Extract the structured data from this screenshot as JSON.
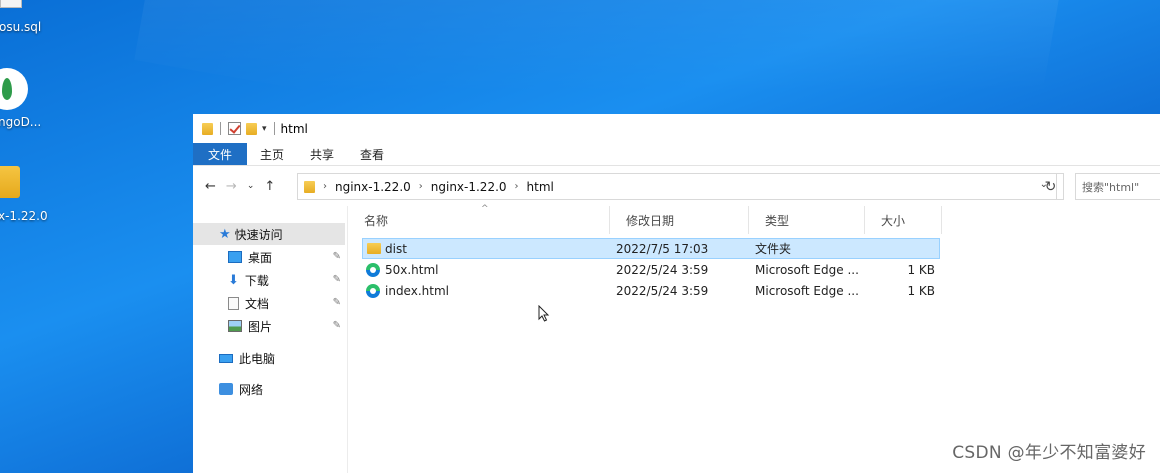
{
  "desktop": {
    "icons": [
      {
        "label": "osu.sql",
        "icon": "sql-file-icon"
      },
      {
        "label": "ngoD...",
        "icon": "mongodb-icon"
      },
      {
        "label": "x-1.22.0",
        "icon": "folder-icon"
      }
    ]
  },
  "window": {
    "title": "html",
    "quick_access_dropdown": "▾"
  },
  "ribbon": {
    "tabs": [
      "文件",
      "主页",
      "共享",
      "查看"
    ]
  },
  "address": {
    "crumbs": [
      "nginx-1.22.0",
      "nginx-1.22.0",
      "html"
    ],
    "search_placeholder": "搜索\"html\""
  },
  "nav_pane": {
    "quick_access": "快速访问",
    "items": [
      "桌面",
      "下载",
      "文档",
      "图片"
    ],
    "this_pc": "此电脑",
    "network": "网络"
  },
  "columns": [
    "名称",
    "修改日期",
    "类型",
    "大小"
  ],
  "files": [
    {
      "name": "dist",
      "date": "2022/7/5 17:03",
      "type": "文件夹",
      "size": "",
      "icon": "folder-icon",
      "selected": true
    },
    {
      "name": "50x.html",
      "date": "2022/5/24 3:59",
      "type": "Microsoft Edge ...",
      "size": "1 KB",
      "icon": "edge-html-icon",
      "selected": false
    },
    {
      "name": "index.html",
      "date": "2022/5/24 3:59",
      "type": "Microsoft Edge ...",
      "size": "1 KB",
      "icon": "edge-html-icon",
      "selected": false
    }
  ],
  "watermark": "CSDN @年少不知富婆好",
  "colors": {
    "desktop": "#0a6fd6",
    "ribbon_file_tab": "#1f6fc4",
    "selection": "#cce8ff",
    "selection_border": "#99d1ff"
  }
}
